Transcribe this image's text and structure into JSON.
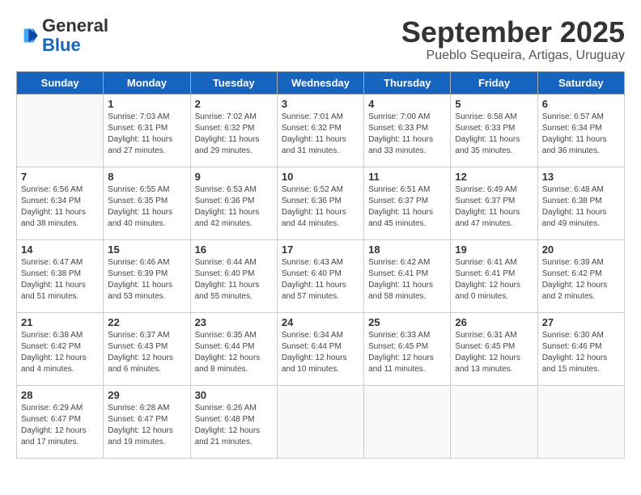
{
  "header": {
    "logo_general": "General",
    "logo_blue": "Blue",
    "month_title": "September 2025",
    "subtitle": "Pueblo Sequeira, Artigas, Uruguay"
  },
  "days_of_week": [
    "Sunday",
    "Monday",
    "Tuesday",
    "Wednesday",
    "Thursday",
    "Friday",
    "Saturday"
  ],
  "weeks": [
    [
      {
        "day": "",
        "info": ""
      },
      {
        "day": "1",
        "info": "Sunrise: 7:03 AM\nSunset: 6:31 PM\nDaylight: 11 hours\nand 27 minutes."
      },
      {
        "day": "2",
        "info": "Sunrise: 7:02 AM\nSunset: 6:32 PM\nDaylight: 11 hours\nand 29 minutes."
      },
      {
        "day": "3",
        "info": "Sunrise: 7:01 AM\nSunset: 6:32 PM\nDaylight: 11 hours\nand 31 minutes."
      },
      {
        "day": "4",
        "info": "Sunrise: 7:00 AM\nSunset: 6:33 PM\nDaylight: 11 hours\nand 33 minutes."
      },
      {
        "day": "5",
        "info": "Sunrise: 6:58 AM\nSunset: 6:33 PM\nDaylight: 11 hours\nand 35 minutes."
      },
      {
        "day": "6",
        "info": "Sunrise: 6:57 AM\nSunset: 6:34 PM\nDaylight: 11 hours\nand 36 minutes."
      }
    ],
    [
      {
        "day": "7",
        "info": "Sunrise: 6:56 AM\nSunset: 6:34 PM\nDaylight: 11 hours\nand 38 minutes."
      },
      {
        "day": "8",
        "info": "Sunrise: 6:55 AM\nSunset: 6:35 PM\nDaylight: 11 hours\nand 40 minutes."
      },
      {
        "day": "9",
        "info": "Sunrise: 6:53 AM\nSunset: 6:36 PM\nDaylight: 11 hours\nand 42 minutes."
      },
      {
        "day": "10",
        "info": "Sunrise: 6:52 AM\nSunset: 6:36 PM\nDaylight: 11 hours\nand 44 minutes."
      },
      {
        "day": "11",
        "info": "Sunrise: 6:51 AM\nSunset: 6:37 PM\nDaylight: 11 hours\nand 45 minutes."
      },
      {
        "day": "12",
        "info": "Sunrise: 6:49 AM\nSunset: 6:37 PM\nDaylight: 11 hours\nand 47 minutes."
      },
      {
        "day": "13",
        "info": "Sunrise: 6:48 AM\nSunset: 6:38 PM\nDaylight: 11 hours\nand 49 minutes."
      }
    ],
    [
      {
        "day": "14",
        "info": "Sunrise: 6:47 AM\nSunset: 6:38 PM\nDaylight: 11 hours\nand 51 minutes."
      },
      {
        "day": "15",
        "info": "Sunrise: 6:46 AM\nSunset: 6:39 PM\nDaylight: 11 hours\nand 53 minutes."
      },
      {
        "day": "16",
        "info": "Sunrise: 6:44 AM\nSunset: 6:40 PM\nDaylight: 11 hours\nand 55 minutes."
      },
      {
        "day": "17",
        "info": "Sunrise: 6:43 AM\nSunset: 6:40 PM\nDaylight: 11 hours\nand 57 minutes."
      },
      {
        "day": "18",
        "info": "Sunrise: 6:42 AM\nSunset: 6:41 PM\nDaylight: 11 hours\nand 58 minutes."
      },
      {
        "day": "19",
        "info": "Sunrise: 6:41 AM\nSunset: 6:41 PM\nDaylight: 12 hours\nand 0 minutes."
      },
      {
        "day": "20",
        "info": "Sunrise: 6:39 AM\nSunset: 6:42 PM\nDaylight: 12 hours\nand 2 minutes."
      }
    ],
    [
      {
        "day": "21",
        "info": "Sunrise: 6:38 AM\nSunset: 6:42 PM\nDaylight: 12 hours\nand 4 minutes."
      },
      {
        "day": "22",
        "info": "Sunrise: 6:37 AM\nSunset: 6:43 PM\nDaylight: 12 hours\nand 6 minutes."
      },
      {
        "day": "23",
        "info": "Sunrise: 6:35 AM\nSunset: 6:44 PM\nDaylight: 12 hours\nand 8 minutes."
      },
      {
        "day": "24",
        "info": "Sunrise: 6:34 AM\nSunset: 6:44 PM\nDaylight: 12 hours\nand 10 minutes."
      },
      {
        "day": "25",
        "info": "Sunrise: 6:33 AM\nSunset: 6:45 PM\nDaylight: 12 hours\nand 11 minutes."
      },
      {
        "day": "26",
        "info": "Sunrise: 6:31 AM\nSunset: 6:45 PM\nDaylight: 12 hours\nand 13 minutes."
      },
      {
        "day": "27",
        "info": "Sunrise: 6:30 AM\nSunset: 6:46 PM\nDaylight: 12 hours\nand 15 minutes."
      }
    ],
    [
      {
        "day": "28",
        "info": "Sunrise: 6:29 AM\nSunset: 6:47 PM\nDaylight: 12 hours\nand 17 minutes."
      },
      {
        "day": "29",
        "info": "Sunrise: 6:28 AM\nSunset: 6:47 PM\nDaylight: 12 hours\nand 19 minutes."
      },
      {
        "day": "30",
        "info": "Sunrise: 6:26 AM\nSunset: 6:48 PM\nDaylight: 12 hours\nand 21 minutes."
      },
      {
        "day": "",
        "info": ""
      },
      {
        "day": "",
        "info": ""
      },
      {
        "day": "",
        "info": ""
      },
      {
        "day": "",
        "info": ""
      }
    ]
  ]
}
